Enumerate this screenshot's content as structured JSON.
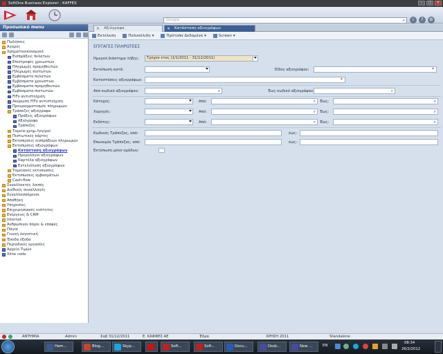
{
  "window": {
    "title": "SoftOne Business Explorer - KAFFES"
  },
  "search": {
    "placeholder": "Google"
  },
  "sidebar": {
    "title": "Προσωπικό menu",
    "items": [
      {
        "label": "Πωλήσεις",
        "icon": "folder",
        "indent": 0
      },
      {
        "label": "Αγορές",
        "icon": "folder",
        "indent": 0
      },
      {
        "label": "Χρηματοοικονομικό",
        "icon": "folder",
        "indent": 0
      },
      {
        "label": "Εισπράξεις πελατών",
        "icon": "doc",
        "indent": 1
      },
      {
        "label": "Επιστροφές χρεωστών",
        "icon": "doc",
        "indent": 1
      },
      {
        "label": "Πληρωμές προμηθευτών",
        "icon": "doc",
        "indent": 1
      },
      {
        "label": "Πληρωμές πιστωτών",
        "icon": "doc",
        "indent": 1
      },
      {
        "label": "Εμβάσματα πελατών",
        "icon": "doc",
        "indent": 1
      },
      {
        "label": "Εμβάσματα χρεωστών",
        "icon": "doc",
        "indent": 1
      },
      {
        "label": "Εμβάσματα προμηθευτών",
        "icon": "doc",
        "indent": 1
      },
      {
        "label": "Εμβάσματα πιστωτών",
        "icon": "doc",
        "indent": 1
      },
      {
        "label": "FIFo αντιστοίχιση",
        "icon": "doc",
        "indent": 1
      },
      {
        "label": "Ακύρωση FIFo αντιστοίχιση",
        "icon": "doc",
        "indent": 1
      },
      {
        "label": "Προγραμματισμός πληρωμών",
        "icon": "doc",
        "indent": 1
      },
      {
        "label": "Τράπεζες αξιόγραφα",
        "icon": "folder",
        "indent": 1
      },
      {
        "label": "Πράξεις αξιογράφων",
        "icon": "doc",
        "indent": 2
      },
      {
        "label": "Αξιόγραφα",
        "icon": "doc",
        "indent": 2
      },
      {
        "label": "Τράπεζες",
        "icon": "doc",
        "indent": 2
      },
      {
        "label": "Ταμεία-χρημ.Λογ/μοί",
        "icon": "folder",
        "indent": 1
      },
      {
        "label": "Πιστωτικές κάρτες",
        "icon": "folder",
        "indent": 1
      },
      {
        "label": "Εκτυπώσεις εισπράξεων πληρωμών",
        "icon": "folder",
        "indent": 1
      },
      {
        "label": "Εκτυπώσεις αξιογράφων",
        "icon": "folder",
        "indent": 1
      },
      {
        "label": "Κατάσταση αξιογράφων",
        "icon": "doc",
        "indent": 2,
        "selected": true
      },
      {
        "label": "Ημερολόγιο αξιογράφων",
        "icon": "doc",
        "indent": 2
      },
      {
        "label": "Καρτέλα αξιογράφων",
        "icon": "doc",
        "indent": 2
      },
      {
        "label": "Εντελιόλυση αξιογράφων",
        "icon": "doc",
        "indent": 2
      },
      {
        "label": "Ταμειακές εκτυπώσεις",
        "icon": "folder",
        "indent": 1
      },
      {
        "label": "Εκτυπώσεις εμβασμάτων",
        "icon": "folder",
        "indent": 1
      },
      {
        "label": "Cash-flow",
        "icon": "folder",
        "indent": 1
      },
      {
        "label": "Συναλλακτές λοιπές",
        "icon": "folder",
        "indent": 0
      },
      {
        "label": "Διεθνείς συναλλαγές",
        "icon": "folder",
        "indent": 0
      },
      {
        "label": "Συναλλασσόμενοι",
        "icon": "folder",
        "indent": 0
      },
      {
        "label": "Αποθήκη",
        "icon": "folder",
        "indent": 0
      },
      {
        "label": "Υπηρεσίες",
        "icon": "folder",
        "indent": 0
      },
      {
        "label": "Επιχειρησιακές ενότητες",
        "icon": "folder",
        "indent": 0
      },
      {
        "label": "Ενέργειες & CRM",
        "icon": "folder",
        "indent": 0
      },
      {
        "label": "Internet",
        "icon": "folder",
        "indent": 0
      },
      {
        "label": "Ανθρώπινοι πόροι & επαφές",
        "icon": "folder",
        "indent": 0
      },
      {
        "label": "Πάγια",
        "icon": "folder",
        "indent": 0
      },
      {
        "label": "Γενική λογιστική",
        "icon": "folder",
        "indent": 0
      },
      {
        "label": "Έσοδα έξοδα",
        "icon": "folder",
        "indent": 0
      },
      {
        "label": "Περιοδικές εργασίες",
        "icon": "folder",
        "indent": 0
      },
      {
        "label": "Αρχείο Τιμών",
        "icon": "doc",
        "indent": 0
      },
      {
        "label": "Xline code",
        "icon": "doc",
        "indent": 0
      }
    ]
  },
  "tabs": [
    {
      "label": "Αξιόγραφα"
    },
    {
      "label": "Κατάσταση αξιογράφων"
    }
  ],
  "actions": {
    "run": "Εκτέλεση",
    "multi": "Πολυσέλιδη",
    "template": "Πρότυπα Δεδομένα",
    "screen": "Screen"
  },
  "form": {
    "section": "ΕΠΙΤΑΓΕΣ ΠΛΗΡΩΤΕΕΣ",
    "period_label": "Ημερολ.διάστημα λήξης:",
    "period_value": "Τρέχον έτος (1/1/2011 - 31/12/2011)",
    "print_by": "Εκτύπωση κατά:",
    "type_label": "Είδος αξιογράφου:",
    "status_label": "Καταστάσεις αξιογράφων:",
    "from_code": "Από κωδικό αξιογράφου:",
    "to_code": "Έως κωδικό αξιογράφου:",
    "holder": "Κάτοχος:",
    "issuer": "Χορηγός:",
    "endorser": "Εκδότης:",
    "from": "Από:",
    "to": "Έως:",
    "bank_code_from": "Κωδικός Τράπεζας, από:",
    "bank_name_from": "Επωνυμία Τράπεζας, από:",
    "bank_to": "έως:",
    "groups_only": "Εκτύπωση μόνο ομάδων:"
  },
  "status": {
    "user": "ΑΝΤΗΜΙΑ",
    "role": "Admin",
    "date": "Σαβ 31/12/2011",
    "company": "Ε. ΚΑΦΦΕΣ ΑΕ",
    "branch": "Έδρα",
    "year": "ΧΡΗΣΗ 2011",
    "mode": "Standalone"
  },
  "taskbar": {
    "items": [
      {
        "label": "Ham...",
        "color": "#3a5a8a"
      },
      {
        "label": "Blog...",
        "color": "#c8442a"
      },
      {
        "label": "Skyp...",
        "color": "#1aa7e0"
      },
      {
        "label": "",
        "color": "#c01616"
      },
      {
        "label": "Soft...",
        "color": "#b22"
      },
      {
        "label": "Soft...",
        "color": "#b22"
      },
      {
        "label": "Docu...",
        "color": "#2a5ab8"
      },
      {
        "label": "Desk...",
        "color": "#4a4a9a"
      },
      {
        "label": "New ...",
        "color": "#4a4a9a"
      }
    ],
    "lang": "EN",
    "time": "08:34",
    "date": "26/2/2012"
  }
}
